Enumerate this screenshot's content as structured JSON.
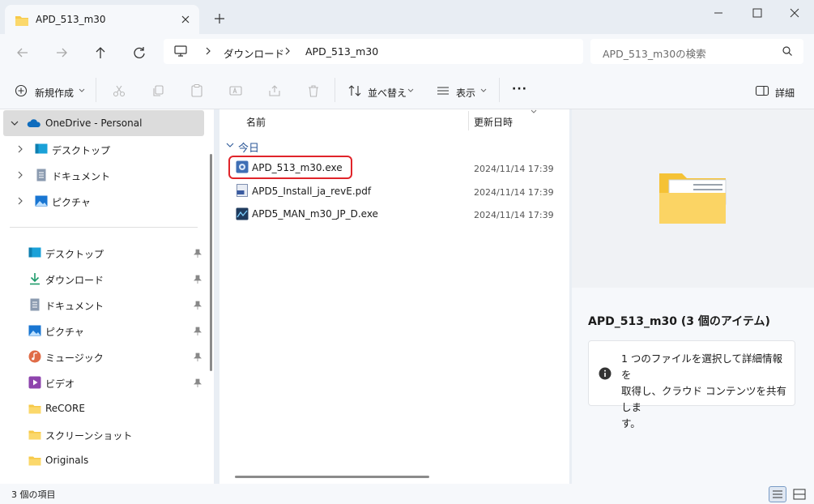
{
  "window": {
    "tab_title": "APD_513_m30",
    "minimize": "—",
    "maximize": "☐",
    "close": "✕"
  },
  "address": {
    "crumbs": [
      "ダウンロード",
      "APD_513_m30"
    ],
    "search_placeholder": "APD_513_m30の検索"
  },
  "toolbar": {
    "new_label": "新規作成",
    "sort_label": "並べ替え",
    "view_label": "表示",
    "more_label": "···",
    "details_label": "詳細"
  },
  "sidebar": {
    "top": [
      {
        "label": "OneDrive - Personal",
        "icon": "onedrive-cloud-icon"
      },
      {
        "label": "デスクトップ",
        "icon": "desktop-icon"
      },
      {
        "label": "ドキュメント",
        "icon": "document-icon"
      },
      {
        "label": "ピクチャ",
        "icon": "pictures-icon"
      }
    ],
    "quick": [
      {
        "label": "デスクトップ",
        "icon": "desktop-icon"
      },
      {
        "label": "ダウンロード",
        "icon": "download-icon"
      },
      {
        "label": "ドキュメント",
        "icon": "document-icon"
      },
      {
        "label": "ピクチャ",
        "icon": "pictures-icon"
      },
      {
        "label": "ミュージック",
        "icon": "music-icon"
      },
      {
        "label": "ビデオ",
        "icon": "video-icon"
      },
      {
        "label": "ReCORE",
        "icon": "folder-icon"
      },
      {
        "label": "スクリーンショット",
        "icon": "folder-icon"
      },
      {
        "label": "Originals",
        "icon": "folder-icon"
      }
    ]
  },
  "filelist": {
    "col_name": "名前",
    "col_date": "更新日時",
    "group_label": "今日",
    "files": [
      {
        "name": "APD_513_m30.exe",
        "date": "2024/11/14 17:39",
        "icon": "installer-exe-icon"
      },
      {
        "name": "APD5_Install_ja_revE.pdf",
        "date": "2024/11/14 17:39",
        "icon": "pdf-file-icon"
      },
      {
        "name": "APD5_MAN_m30_JP_D.exe",
        "date": "2024/11/14 17:39",
        "icon": "exe-app-icon"
      }
    ]
  },
  "preview": {
    "title": "APD_513_m30 (3 個のアイテム)",
    "info_line1": "1 つのファイルを選択して詳細情報を",
    "info_line2": "取得し、クラウド コンテンツを共有しま",
    "info_line3": "す。"
  },
  "status": {
    "count_text": "3 個の項目"
  },
  "colors": {
    "highlight_border": "#e0242a",
    "folder_yellow": "#f7c948",
    "onedrive_blue": "#0f6cbd"
  }
}
